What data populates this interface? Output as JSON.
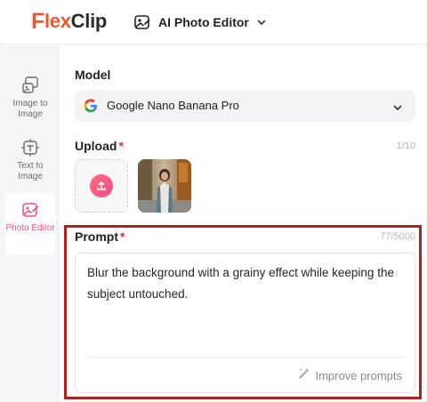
{
  "brand": {
    "logo_f": "F",
    "logo_lex": "lex",
    "logo_clip": "Clip",
    "accent": "#f0572c"
  },
  "header": {
    "tool_label": "AI Photo Editor",
    "tool_icon": "photo-edit-icon",
    "dropdown_icon": "chevron-down-icon"
  },
  "sidebar": {
    "items": [
      {
        "label": "Image to Image",
        "icon": "image-to-image-icon"
      },
      {
        "label": "Text to Image",
        "icon": "text-to-image-icon"
      },
      {
        "label": "Photo Editor",
        "icon": "photo-editor-icon",
        "active": true
      }
    ],
    "active_color": "#f04f8a"
  },
  "model": {
    "label": "Model",
    "selected": "Google Nano Banana Pro"
  },
  "upload": {
    "label": "Upload",
    "required_mark": "*",
    "count": "1/10"
  },
  "prompt": {
    "label": "Prompt",
    "required_mark": "*",
    "count": "77/5000",
    "text": "Blur the background with a grainy effect while keeping the subject untouched.",
    "improve_label": "Improve prompts",
    "highlight_color": "#b0201c"
  }
}
